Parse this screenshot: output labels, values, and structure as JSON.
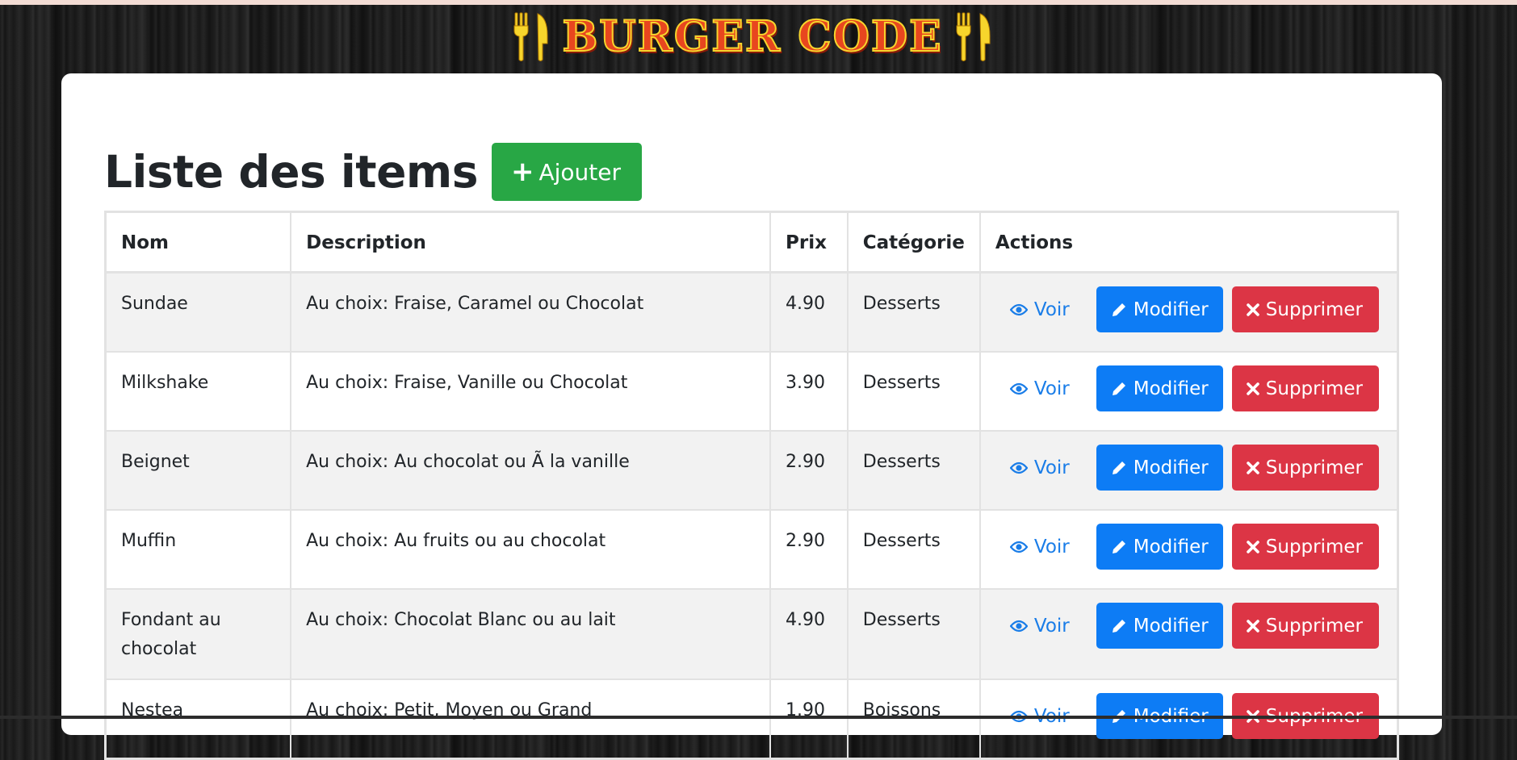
{
  "site": {
    "logo_text": "BURGER CODE",
    "colors": {
      "logo_fill": "#e8461f",
      "logo_outline": "#f7d52c",
      "background": "#161616"
    }
  },
  "page": {
    "title": "Liste des items",
    "add_button": {
      "label": "Ajouter",
      "icon": "plus-icon",
      "color": "#28a745"
    }
  },
  "table": {
    "headers": {
      "nom": "Nom",
      "description": "Description",
      "prix": "Prix",
      "categorie": "Catégorie",
      "actions": "Actions"
    },
    "rows": [
      {
        "nom": "Sundae",
        "description": "Au choix: Fraise, Caramel ou Chocolat",
        "prix": "4.90",
        "categorie": "Desserts"
      },
      {
        "nom": "Milkshake",
        "description": "Au choix: Fraise, Vanille ou Chocolat",
        "prix": "3.90",
        "categorie": "Desserts"
      },
      {
        "nom": "Beignet",
        "description": "Au choix: Au chocolat ou Ã  la vanille",
        "prix": "2.90",
        "categorie": "Desserts"
      },
      {
        "nom": "Muffin",
        "description": "Au choix: Au fruits ou au chocolat",
        "prix": "2.90",
        "categorie": "Desserts"
      },
      {
        "nom": "Fondant au chocolat",
        "description": "Au choix: Chocolat Blanc ou au lait",
        "prix": "4.90",
        "categorie": "Desserts"
      },
      {
        "nom": "Nestea",
        "description": "Au choix: Petit, Moyen ou Grand",
        "prix": "1.90",
        "categorie": "Boissons"
      }
    ],
    "actions": {
      "view_label": "Voir",
      "view_icon": "eye-icon",
      "edit_label": "Modifier",
      "edit_icon": "pencil-icon",
      "delete_label": "Supprimer",
      "delete_icon": "close-icon",
      "colors": {
        "view": "#1a7de8",
        "edit": "#0d7cf5",
        "delete": "#dc3545"
      }
    }
  }
}
